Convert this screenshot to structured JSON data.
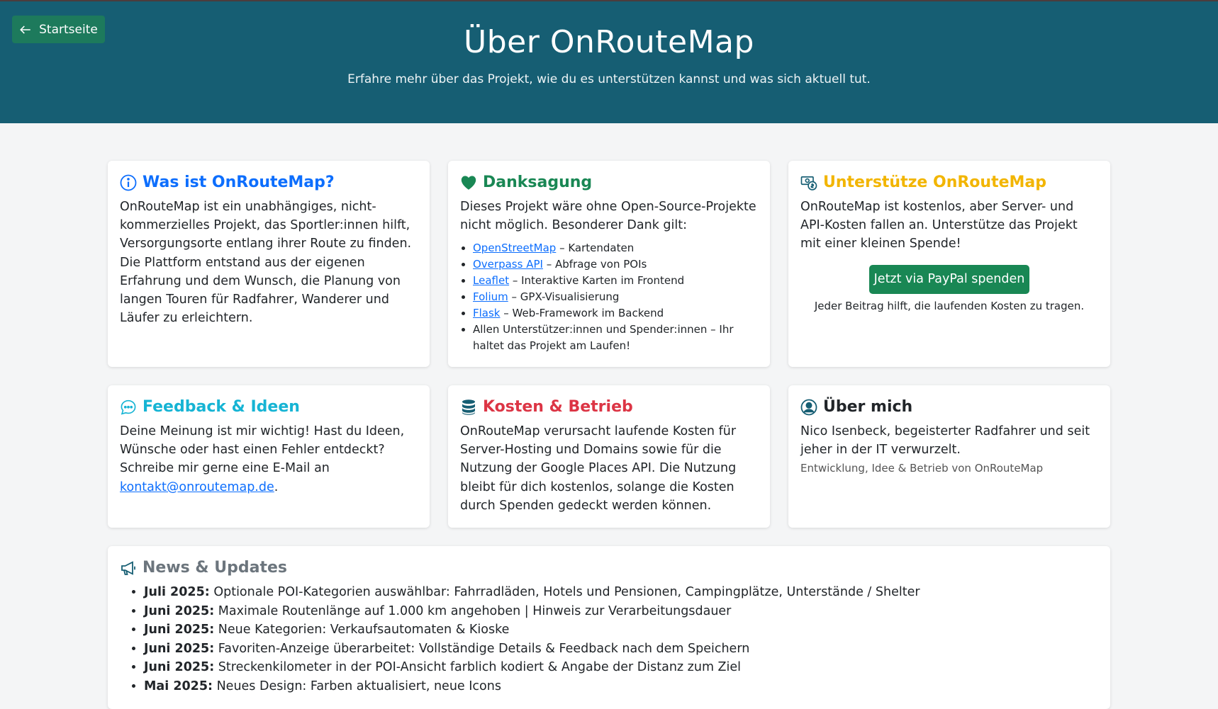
{
  "header": {
    "back_label": "Startseite",
    "title": "Über OnRouteMap",
    "subtitle": "Erfahre mehr über das Projekt, wie du es unterstützen kannst und was sich aktuell tut."
  },
  "about": {
    "title": "Was ist OnRouteMap?",
    "text": "OnRouteMap ist ein unabhängiges, nicht-kommerzielles Projekt, das Sportler:innen hilft, Versorgungsorte entlang ihrer Route zu finden. Die Plattform entstand aus der eigenen Erfahrung und dem Wunsch, die Planung von langen Touren für Radfahrer, Wanderer und Läufer zu erleichtern."
  },
  "thanks": {
    "title": "Danksagung",
    "intro": "Dieses Projekt wäre ohne Open-Source-Projekte nicht möglich. Besonderer Dank gilt:",
    "items": [
      {
        "link": "OpenStreetMap",
        "text": " – Kartendaten"
      },
      {
        "link": "Overpass API",
        "text": " – Abfrage von POIs"
      },
      {
        "link": "Leaflet",
        "text": " – Interaktive Karten im Frontend"
      },
      {
        "link": "Folium",
        "text": " – GPX-Visualisierung"
      },
      {
        "link": "Flask",
        "text": " – Web-Framework im Backend"
      }
    ],
    "last_item": "Allen Unterstützer:innen und Spender:innen – Ihr haltet das Projekt am Laufen!"
  },
  "support": {
    "title": "Unterstütze OnRouteMap",
    "text": "OnRouteMap ist kostenlos, aber Server- und API-Kosten fallen an. Unterstütze das Projekt mit einer kleinen Spende!",
    "button": "Jetzt via PayPal spenden",
    "note": "Jeder Beitrag hilft, die laufenden Kosten zu tragen."
  },
  "feedback": {
    "title": "Feedback & Ideen",
    "text": "Deine Meinung ist mir wichtig! Hast du Ideen, Wünsche oder hast einen Fehler entdeckt? Schreibe mir gerne eine E-Mail an",
    "email": "kontakt@onroutemap.de",
    "suffix": "."
  },
  "costs": {
    "title": "Kosten & Betrieb",
    "text": "OnRouteMap verursacht laufende Kosten für Server-Hosting und Domains sowie für die Nutzung der Google Places API. Die Nutzung bleibt für dich kostenlos, solange die Kosten durch Spenden gedeckt werden können."
  },
  "me": {
    "title": "Über mich",
    "text": "Nico Isenbeck, begeisterter Radfahrer und seit jeher in der IT verwurzelt.",
    "caption": "Entwicklung, Idee & Betrieb von OnRouteMap"
  },
  "news": {
    "title": "News & Updates",
    "items": [
      {
        "date": "Juli 2025:",
        "text": " Optionale POI-Kategorien auswählbar: Fahrradläden, Hotels und Pensionen, Campingplätze, Unterstände / Shelter"
      },
      {
        "date": "Juni 2025:",
        "text": " Maximale Routenlänge auf 1.000 km angehoben | Hinweis zur Verarbeitungsdauer"
      },
      {
        "date": "Juni 2025:",
        "text": " Neue Kategorien: Verkaufsautomaten & Kioske"
      },
      {
        "date": "Juni 2025:",
        "text": " Favoriten-Anzeige überarbeitet: Vollständige Details & Feedback nach dem Speichern"
      },
      {
        "date": "Juni 2025:",
        "text": " Streckenkilometer in der POI-Ansicht farblich kodiert & Angabe der Distanz zum Ziel"
      },
      {
        "date": "Mai 2025:",
        "text": " Neues Design: Farben aktualisiert, neue Icons"
      }
    ]
  },
  "colors": {
    "header_bg": "#165e73",
    "back_button": "#1d7a5c",
    "blue": "#0d6efd",
    "green": "#198754",
    "yellow": "#f2b500",
    "cyan": "#16b4d4",
    "red": "#dc3545",
    "grey": "#6c757d"
  },
  "icons": [
    "arrow-left-icon",
    "info-icon",
    "heart-icon",
    "cash-icon",
    "chat-icon",
    "database-icon",
    "person-circle-icon",
    "megaphone-icon"
  ]
}
